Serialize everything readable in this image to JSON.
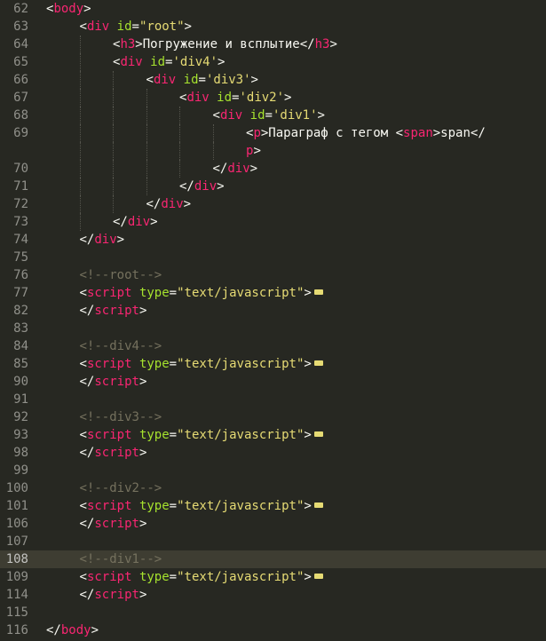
{
  "editor": {
    "theme": {
      "background": "#272822",
      "tag": "#f92672",
      "attribute": "#a6e22e",
      "string": "#e6db74",
      "comment": "#75715e",
      "text": "#f8f8f2",
      "gutter": "#90908a",
      "fold_marker": "#e6db74"
    },
    "lines": [
      {
        "num": "62",
        "indent": 1,
        "tokens": [
          {
            "t": "punc",
            "v": "<"
          },
          {
            "t": "tag",
            "v": "body"
          },
          {
            "t": "punc",
            "v": ">"
          }
        ]
      },
      {
        "num": "63",
        "indent": 2,
        "tokens": [
          {
            "t": "punc",
            "v": "<"
          },
          {
            "t": "tag",
            "v": "div"
          },
          {
            "t": "punc",
            "v": " "
          },
          {
            "t": "attr",
            "v": "id"
          },
          {
            "t": "punc",
            "v": "="
          },
          {
            "t": "str",
            "v": "\"root\""
          },
          {
            "t": "punc",
            "v": ">"
          }
        ]
      },
      {
        "num": "64",
        "indent": 3,
        "tokens": [
          {
            "t": "punc",
            "v": "<"
          },
          {
            "t": "tag",
            "v": "h3"
          },
          {
            "t": "punc",
            "v": ">Погружение и всплытие</"
          },
          {
            "t": "tag",
            "v": "h3"
          },
          {
            "t": "punc",
            "v": ">"
          }
        ]
      },
      {
        "num": "65",
        "indent": 3,
        "tokens": [
          {
            "t": "punc",
            "v": "<"
          },
          {
            "t": "tag",
            "v": "div"
          },
          {
            "t": "punc",
            "v": " "
          },
          {
            "t": "attr",
            "v": "id"
          },
          {
            "t": "punc",
            "v": "="
          },
          {
            "t": "str",
            "v": "'div4'"
          },
          {
            "t": "punc",
            "v": ">"
          }
        ]
      },
      {
        "num": "66",
        "indent": 4,
        "tokens": [
          {
            "t": "punc",
            "v": "<"
          },
          {
            "t": "tag",
            "v": "div"
          },
          {
            "t": "punc",
            "v": " "
          },
          {
            "t": "attr",
            "v": "id"
          },
          {
            "t": "punc",
            "v": "="
          },
          {
            "t": "str",
            "v": "'div3'"
          },
          {
            "t": "punc",
            "v": ">"
          }
        ]
      },
      {
        "num": "67",
        "indent": 5,
        "tokens": [
          {
            "t": "punc",
            "v": "<"
          },
          {
            "t": "tag",
            "v": "div"
          },
          {
            "t": "punc",
            "v": " "
          },
          {
            "t": "attr",
            "v": "id"
          },
          {
            "t": "punc",
            "v": "="
          },
          {
            "t": "str",
            "v": "'div2'"
          },
          {
            "t": "punc",
            "v": ">"
          }
        ]
      },
      {
        "num": "68",
        "indent": 6,
        "tokens": [
          {
            "t": "punc",
            "v": "<"
          },
          {
            "t": "tag",
            "v": "div"
          },
          {
            "t": "punc",
            "v": " "
          },
          {
            "t": "attr",
            "v": "id"
          },
          {
            "t": "punc",
            "v": "="
          },
          {
            "t": "str",
            "v": "'div1'"
          },
          {
            "t": "punc",
            "v": ">"
          }
        ]
      },
      {
        "num": "69",
        "indent": 7,
        "tokens": [
          {
            "t": "punc",
            "v": "<"
          },
          {
            "t": "tag",
            "v": "p"
          },
          {
            "t": "punc",
            "v": ">Параграф с тегом <"
          },
          {
            "t": "tag",
            "v": "span"
          },
          {
            "t": "punc",
            "v": ">span</"
          }
        ]
      },
      {
        "num": "",
        "indent": 7,
        "tokens": [
          {
            "t": "tag",
            "v": "p"
          },
          {
            "t": "punc",
            "v": ">"
          }
        ]
      },
      {
        "num": "70",
        "indent": 6,
        "tokens": [
          {
            "t": "punc",
            "v": "</"
          },
          {
            "t": "tag",
            "v": "div"
          },
          {
            "t": "punc",
            "v": ">"
          }
        ]
      },
      {
        "num": "71",
        "indent": 5,
        "tokens": [
          {
            "t": "punc",
            "v": "</"
          },
          {
            "t": "tag",
            "v": "div"
          },
          {
            "t": "punc",
            "v": ">"
          }
        ]
      },
      {
        "num": "72",
        "indent": 4,
        "tokens": [
          {
            "t": "punc",
            "v": "</"
          },
          {
            "t": "tag",
            "v": "div"
          },
          {
            "t": "punc",
            "v": ">"
          }
        ]
      },
      {
        "num": "73",
        "indent": 3,
        "tokens": [
          {
            "t": "punc",
            "v": "</"
          },
          {
            "t": "tag",
            "v": "div"
          },
          {
            "t": "punc",
            "v": ">"
          }
        ]
      },
      {
        "num": "74",
        "indent": 2,
        "tokens": [
          {
            "t": "punc",
            "v": "</"
          },
          {
            "t": "tag",
            "v": "div"
          },
          {
            "t": "punc",
            "v": ">"
          }
        ]
      },
      {
        "num": "75",
        "indent": 2,
        "tokens": []
      },
      {
        "num": "76",
        "indent": 2,
        "tokens": [
          {
            "t": "cmt",
            "v": "<!--root-->"
          }
        ]
      },
      {
        "num": "77",
        "indent": 2,
        "fold": true,
        "tokens": [
          {
            "t": "punc",
            "v": "<"
          },
          {
            "t": "tag",
            "v": "script"
          },
          {
            "t": "punc",
            "v": " "
          },
          {
            "t": "attr",
            "v": "type"
          },
          {
            "t": "punc",
            "v": "="
          },
          {
            "t": "str",
            "v": "\"text/javascript\""
          },
          {
            "t": "punc",
            "v": ">"
          }
        ]
      },
      {
        "num": "82",
        "indent": 2,
        "tokens": [
          {
            "t": "punc",
            "v": "</"
          },
          {
            "t": "tag",
            "v": "script"
          },
          {
            "t": "punc",
            "v": ">"
          }
        ]
      },
      {
        "num": "83",
        "indent": 2,
        "tokens": []
      },
      {
        "num": "84",
        "indent": 2,
        "tokens": [
          {
            "t": "cmt",
            "v": "<!--div4-->"
          }
        ]
      },
      {
        "num": "85",
        "indent": 2,
        "fold": true,
        "tokens": [
          {
            "t": "punc",
            "v": "<"
          },
          {
            "t": "tag",
            "v": "script"
          },
          {
            "t": "punc",
            "v": " "
          },
          {
            "t": "attr",
            "v": "type"
          },
          {
            "t": "punc",
            "v": "="
          },
          {
            "t": "str",
            "v": "\"text/javascript\""
          },
          {
            "t": "punc",
            "v": ">"
          }
        ]
      },
      {
        "num": "90",
        "indent": 2,
        "tokens": [
          {
            "t": "punc",
            "v": "</"
          },
          {
            "t": "tag",
            "v": "script"
          },
          {
            "t": "punc",
            "v": ">"
          }
        ]
      },
      {
        "num": "91",
        "indent": 2,
        "tokens": []
      },
      {
        "num": "92",
        "indent": 2,
        "tokens": [
          {
            "t": "cmt",
            "v": "<!--div3-->"
          }
        ]
      },
      {
        "num": "93",
        "indent": 2,
        "fold": true,
        "tokens": [
          {
            "t": "punc",
            "v": "<"
          },
          {
            "t": "tag",
            "v": "script"
          },
          {
            "t": "punc",
            "v": " "
          },
          {
            "t": "attr",
            "v": "type"
          },
          {
            "t": "punc",
            "v": "="
          },
          {
            "t": "str",
            "v": "\"text/javascript\""
          },
          {
            "t": "punc",
            "v": ">"
          }
        ]
      },
      {
        "num": "98",
        "indent": 2,
        "tokens": [
          {
            "t": "punc",
            "v": "</"
          },
          {
            "t": "tag",
            "v": "script"
          },
          {
            "t": "punc",
            "v": ">"
          }
        ]
      },
      {
        "num": "99",
        "indent": 2,
        "tokens": []
      },
      {
        "num": "100",
        "indent": 2,
        "tokens": [
          {
            "t": "cmt",
            "v": "<!--div2-->"
          }
        ]
      },
      {
        "num": "101",
        "indent": 2,
        "fold": true,
        "tokens": [
          {
            "t": "punc",
            "v": "<"
          },
          {
            "t": "tag",
            "v": "script"
          },
          {
            "t": "punc",
            "v": " "
          },
          {
            "t": "attr",
            "v": "type"
          },
          {
            "t": "punc",
            "v": "="
          },
          {
            "t": "str",
            "v": "\"text/javascript\""
          },
          {
            "t": "punc",
            "v": ">"
          }
        ]
      },
      {
        "num": "106",
        "indent": 2,
        "tokens": [
          {
            "t": "punc",
            "v": "</"
          },
          {
            "t": "tag",
            "v": "script"
          },
          {
            "t": "punc",
            "v": ">"
          }
        ]
      },
      {
        "num": "107",
        "indent": 2,
        "tokens": []
      },
      {
        "num": "108",
        "indent": 2,
        "active": true,
        "tokens": [
          {
            "t": "cmt",
            "v": "<!--div1-->"
          }
        ]
      },
      {
        "num": "109",
        "indent": 2,
        "fold": true,
        "tokens": [
          {
            "t": "punc",
            "v": "<"
          },
          {
            "t": "tag",
            "v": "script"
          },
          {
            "t": "punc",
            "v": " "
          },
          {
            "t": "attr",
            "v": "type"
          },
          {
            "t": "punc",
            "v": "="
          },
          {
            "t": "str",
            "v": "\"text/javascript\""
          },
          {
            "t": "punc",
            "v": ">"
          }
        ]
      },
      {
        "num": "114",
        "indent": 2,
        "tokens": [
          {
            "t": "punc",
            "v": "</"
          },
          {
            "t": "tag",
            "v": "script"
          },
          {
            "t": "punc",
            "v": ">"
          }
        ]
      },
      {
        "num": "115",
        "indent": 1,
        "tokens": []
      },
      {
        "num": "116",
        "indent": 1,
        "tokens": [
          {
            "t": "punc",
            "v": "</"
          },
          {
            "t": "tag",
            "v": "body"
          },
          {
            "t": "punc",
            "v": ">"
          }
        ]
      }
    ]
  }
}
